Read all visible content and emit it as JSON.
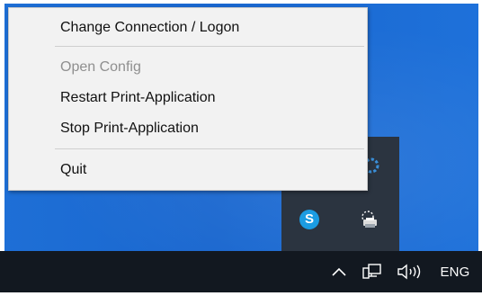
{
  "context_menu": {
    "items": [
      {
        "label": "Change Connection / Logon",
        "enabled": true
      },
      {
        "label": "Open Config",
        "enabled": false
      },
      {
        "label": "Restart Print-Application",
        "enabled": true
      },
      {
        "label": "Stop Print-Application",
        "enabled": true
      },
      {
        "label": "Quit",
        "enabled": true
      }
    ]
  },
  "tray_flyout": {
    "icons": [
      "ring-app-icon",
      "skype-icon",
      "printer-app-icon"
    ],
    "skype_letter": "S"
  },
  "taskbar": {
    "tray_icons": [
      "chevron-up-icon",
      "network-icon",
      "volume-icon"
    ],
    "language": "ENG"
  },
  "colors": {
    "desktop": "#1f6ed4",
    "taskbar": "#121820",
    "flyout": "#2b3440",
    "menu_background": "#f2f2f2",
    "disabled_text": "#8f8f8f",
    "skype": "#1b9ce2"
  }
}
